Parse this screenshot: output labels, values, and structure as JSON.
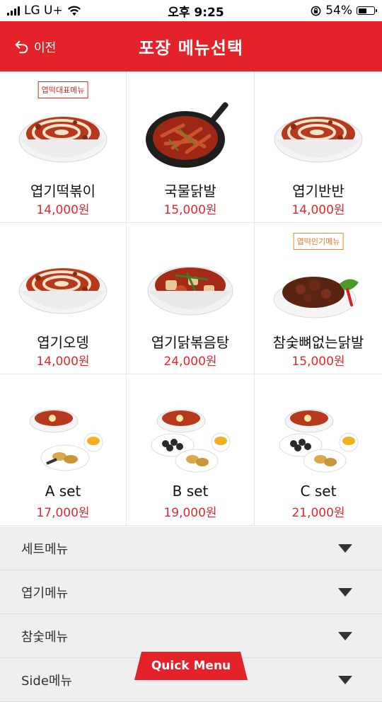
{
  "status": {
    "carrier": "LG U+",
    "time": "오후 9:25",
    "battery": "54%",
    "battery_level": 0.54
  },
  "header": {
    "back_label": "이전",
    "title": "포장 메뉴선택"
  },
  "menu": [
    {
      "name": "엽기떡볶이",
      "price": "14,000원",
      "badge": "엽떡대표메뉴",
      "badge_style": "red",
      "image": "tteokbokki-bowl"
    },
    {
      "name": "국물닭발",
      "price": "15,000원",
      "badge": "",
      "badge_style": "",
      "image": "chicken-feet-pan"
    },
    {
      "name": "엽기반반",
      "price": "14,000원",
      "badge": "",
      "badge_style": "",
      "image": "tteokbokki-bowl"
    },
    {
      "name": "엽기오뎅",
      "price": "14,000원",
      "badge": "",
      "badge_style": "",
      "image": "tteokbokki-bowl"
    },
    {
      "name": "엽기닭볶음탕",
      "price": "24,000원",
      "badge": "",
      "badge_style": "",
      "image": "chicken-stew-bowl"
    },
    {
      "name": "참숯뼈없는닭발",
      "price": "15,000원",
      "badge": "엽떡인기메뉴",
      "badge_style": "orange",
      "image": "boneless-chicken-feet-plate"
    },
    {
      "name": "A set",
      "price": "17,000원",
      "badge": "",
      "badge_style": "",
      "image": "set-a"
    },
    {
      "name": "B set",
      "price": "19,000원",
      "badge": "",
      "badge_style": "",
      "image": "set-b"
    },
    {
      "name": "C set",
      "price": "21,000원",
      "badge": "",
      "badge_style": "",
      "image": "set-c"
    }
  ],
  "accordion": [
    {
      "label": "세트메뉴"
    },
    {
      "label": "엽기메뉴"
    },
    {
      "label": "참숯메뉴"
    },
    {
      "label": "Side메뉴"
    }
  ],
  "quick_menu_label": "Quick Menu",
  "colors": {
    "brand_red": "#e4222a",
    "price_red": "#e0282e",
    "badge_orange": "#e08020"
  }
}
